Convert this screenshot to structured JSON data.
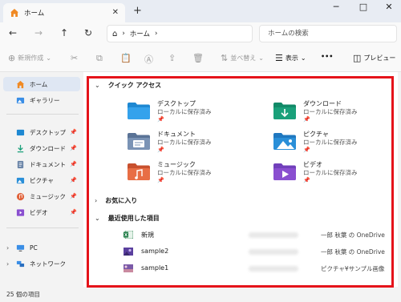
{
  "window": {
    "tab_title": "ホーム",
    "tab_close": "✕",
    "new_tab": "+",
    "controls": {
      "minimize": "─",
      "maximize": "□",
      "close": "✕"
    }
  },
  "nav": {
    "back": "←",
    "forward": "→",
    "up": "↑",
    "refresh": "↻",
    "address_home": "⌂",
    "sep1": "›",
    "address_segment": "ホーム",
    "sep2": "›",
    "search_placeholder": "ホームの検索"
  },
  "commands": {
    "new_label": "新規作成",
    "sort_label": "並べ替え",
    "view_label": "表示",
    "more": "•••",
    "preview_label": "プレビュー"
  },
  "sidebar": {
    "home": "ホーム",
    "gallery": "ギャラリー",
    "quick": [
      "デスクトップ",
      "ダウンロード",
      "ドキュメント",
      "ピクチャ",
      "ミュージック",
      "ビデオ"
    ],
    "pc": "PC",
    "network": "ネットワーク",
    "pin_glyph": "📌",
    "chevron": "›"
  },
  "main": {
    "quick_access_header": "クイック アクセス",
    "favorites_header": "お気に入り",
    "recent_header": "最近使用した項目",
    "chev_open": "⌄",
    "chev_closed": "›",
    "quick_items": [
      {
        "name": "デスクトップ",
        "sub": "ローカルに保存済み",
        "color": "#1e88d2"
      },
      {
        "name": "ダウンロード",
        "sub": "ローカルに保存済み",
        "color": "#1aa07a"
      },
      {
        "name": "ドキュメント",
        "sub": "ローカルに保存済み",
        "color": "#6b85a8"
      },
      {
        "name": "ピクチャ",
        "sub": "ローカルに保存済み",
        "color": "#2a8fd8"
      },
      {
        "name": "ミュージック",
        "sub": "ローカルに保存済み",
        "color": "#e0623a"
      },
      {
        "name": "ビデオ",
        "sub": "ローカルに保存済み",
        "color": "#8a4fd0"
      }
    ],
    "recent_items": [
      {
        "name": "新規",
        "location": "一郎 秋葉 の OneDrive"
      },
      {
        "name": "sample2",
        "location": "一郎 秋葉 の OneDrive"
      },
      {
        "name": "sample1",
        "location": "ピクチャ¥サンプル画像"
      }
    ]
  },
  "status": {
    "count": "25 個の項目"
  },
  "colors": {
    "highlight_frame": "#e5131a",
    "home_icon": "#f08a24",
    "accent": "#0067c0"
  }
}
